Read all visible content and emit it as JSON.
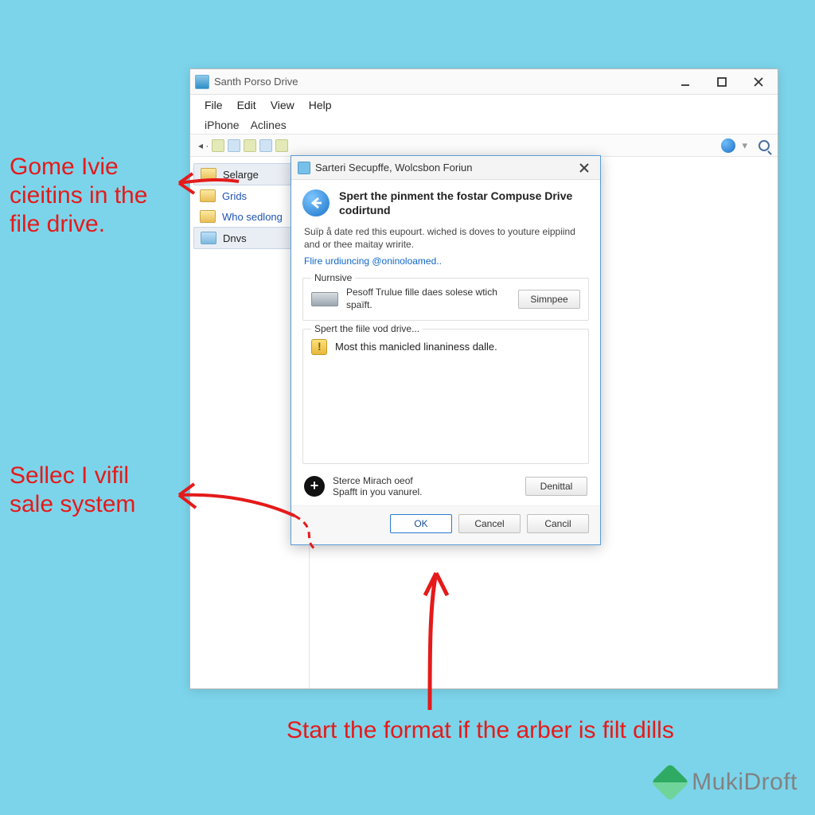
{
  "annotations": {
    "top": "Gome Ivie cieitins in the file drive.",
    "middle": "Sellec I vifil sale system",
    "bottom": "Start the format if the arber is filt dills"
  },
  "main_window": {
    "title": "Santh Porso Drive",
    "menu": {
      "file": "File",
      "edit": "Edit",
      "view": "View",
      "help": "Help"
    },
    "tabs": {
      "iphone": "iPhone",
      "aclines": "Aclines"
    },
    "sidebar": [
      {
        "label": "Selarge"
      },
      {
        "label": "Grids"
      },
      {
        "label": "Who sedlong"
      },
      {
        "label": "Dnvs"
      }
    ]
  },
  "dialog": {
    "title": "Sarteri Secupffe, Wolcsbon Foriun",
    "heading": "Spert the pinment the fostar Compuse Drive codirtund",
    "subtext": "Suïp å date red this eupourt. wiched is doves to youture eippiind and or thee maitay wririte.",
    "link": "Flire urdiuncing @oninoloamed..",
    "group1_legend": "Nurnsive",
    "group1_text": "Pesoff Trulue fille daes solese wtich spaïft.",
    "group1_button": "Simnpee",
    "group2_legend": "Spert the fiile vod drive...",
    "group2_text": "Most this manicled linaniness dalle.",
    "extra_line1": "Sterce Mirach oeof",
    "extra_line2": "Spafft in you vanurel.",
    "extra_button": "Denittal",
    "ok": "OK",
    "cancel1": "Cancel",
    "cancel2": "Cancil"
  },
  "watermark": "MukiDroft"
}
